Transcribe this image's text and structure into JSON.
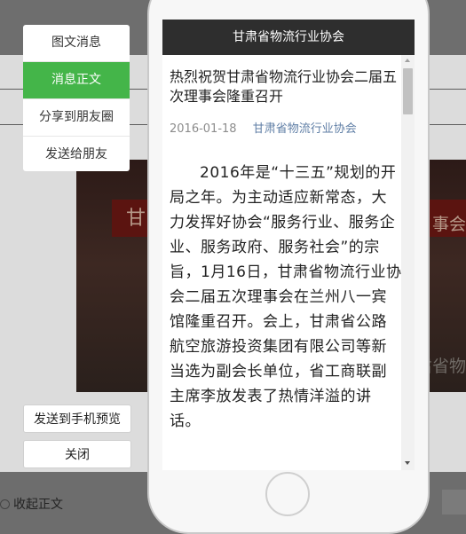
{
  "menu": {
    "items": [
      {
        "label": "图文消息",
        "active": false
      },
      {
        "label": "消息正文",
        "active": true
      },
      {
        "label": "分享到朋友圈",
        "active": false
      },
      {
        "label": "发送给朋友",
        "active": false
      }
    ]
  },
  "buttons": {
    "send_preview": "发送到手机预览",
    "close": "关闭"
  },
  "footer": {
    "collapse_label": "收起正文"
  },
  "background_photo": {
    "banner_left": "甘",
    "banner_right": "事会",
    "mark": "甘肃省物"
  },
  "phone": {
    "header_title": "甘肃省物流行业协会",
    "article": {
      "title": "热烈祝贺甘肃省物流行业协会二届五次理事会隆重召开",
      "date": "2016-01-18",
      "account": "甘肃省物流行业协会",
      "body": "2016年是“十三五”规划的开局之年。为主动适应新常态，大力发挥好协会“服务行业、服务企业、服务政府、服务社会”的宗旨，1月16日，甘肃省物流行业协会二届五次理事会在兰州八一宾馆隆重召开。会上，甘肃省公路航空旅游投资集团有限公司等新当选为副会长单位，省工商联副主席李放发表了热情洋溢的讲话。"
    }
  },
  "colors": {
    "accent_green": "#44b549",
    "header_dark": "#2e2e2e",
    "account_link": "#607fa6"
  }
}
